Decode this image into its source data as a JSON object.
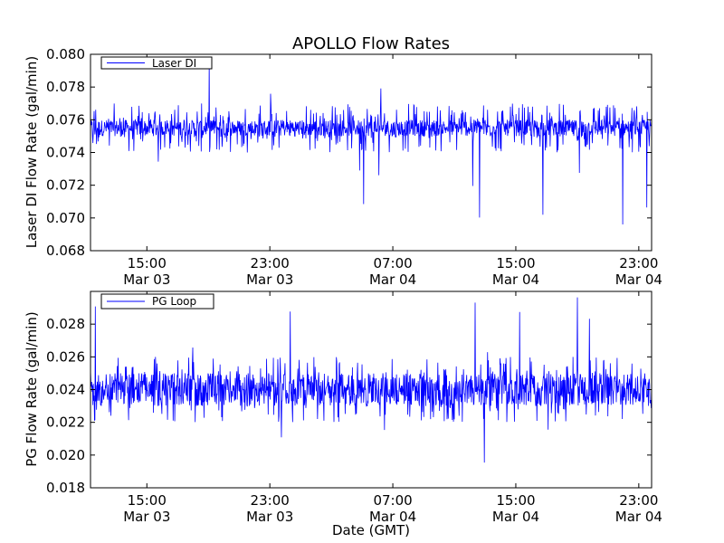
{
  "figure": {
    "title": "APOLLO Flow Rates",
    "xlabel": "Date (GMT)"
  },
  "chart_data": [
    {
      "type": "line",
      "title": "APOLLO Flow Rates",
      "xlabel": "",
      "ylabel": "Laser DI Flow Rate (gal/min)",
      "ylim": [
        0.068,
        0.08
      ],
      "yticks": [
        "0.068",
        "0.070",
        "0.072",
        "0.074",
        "0.076",
        "0.078",
        "0.080"
      ],
      "xlim": [
        "2012-03-03 11:20",
        "2012-03-04 23:50"
      ],
      "xticks": [
        {
          "time": "2012-03-03 15:00",
          "label_time": "15:00",
          "label_date": "Mar 03"
        },
        {
          "time": "2012-03-03 23:00",
          "label_time": "23:00",
          "label_date": "Mar 03"
        },
        {
          "time": "2012-03-04 07:00",
          "label_time": "07:00",
          "label_date": "Mar 04"
        },
        {
          "time": "2012-03-04 15:00",
          "label_time": "15:00",
          "label_date": "Mar 04"
        },
        {
          "time": "2012-03-04 23:00",
          "label_time": "23:00",
          "label_date": "Mar 04"
        }
      ],
      "legend_loc": "upper-left",
      "series": [
        {
          "name": "Laser DI",
          "color": "#0000ff",
          "baseline_band": [
            0.075,
            0.076
          ],
          "typical_range": [
            0.074,
            0.077
          ],
          "min_value": 0.069,
          "max_value": 0.08
        }
      ]
    },
    {
      "type": "line",
      "title": "",
      "xlabel": "Date (GMT)",
      "ylabel": "PG Flow Rate (gal/min)",
      "ylim": [
        0.018,
        0.03
      ],
      "yticks": [
        "0.018",
        "0.020",
        "0.022",
        "0.024",
        "0.026",
        "0.028"
      ],
      "xlim": [
        "2012-03-03 11:20",
        "2012-03-04 23:50"
      ],
      "xticks": [
        {
          "time": "2012-03-03 15:00",
          "label_time": "15:00",
          "label_date": "Mar 03"
        },
        {
          "time": "2012-03-03 23:00",
          "label_time": "23:00",
          "label_date": "Mar 03"
        },
        {
          "time": "2012-03-04 07:00",
          "label_time": "07:00",
          "label_date": "Mar 04"
        },
        {
          "time": "2012-03-04 15:00",
          "label_time": "15:00",
          "label_date": "Mar 04"
        },
        {
          "time": "2012-03-04 23:00",
          "label_time": "23:00",
          "label_date": "Mar 04"
        }
      ],
      "legend_loc": "upper-left",
      "series": [
        {
          "name": "PG Loop",
          "color": "#0000ff",
          "baseline_band": [
            0.023,
            0.025
          ],
          "typical_range": [
            0.022,
            0.026
          ],
          "min_value": 0.018,
          "max_value": 0.03
        }
      ]
    }
  ]
}
